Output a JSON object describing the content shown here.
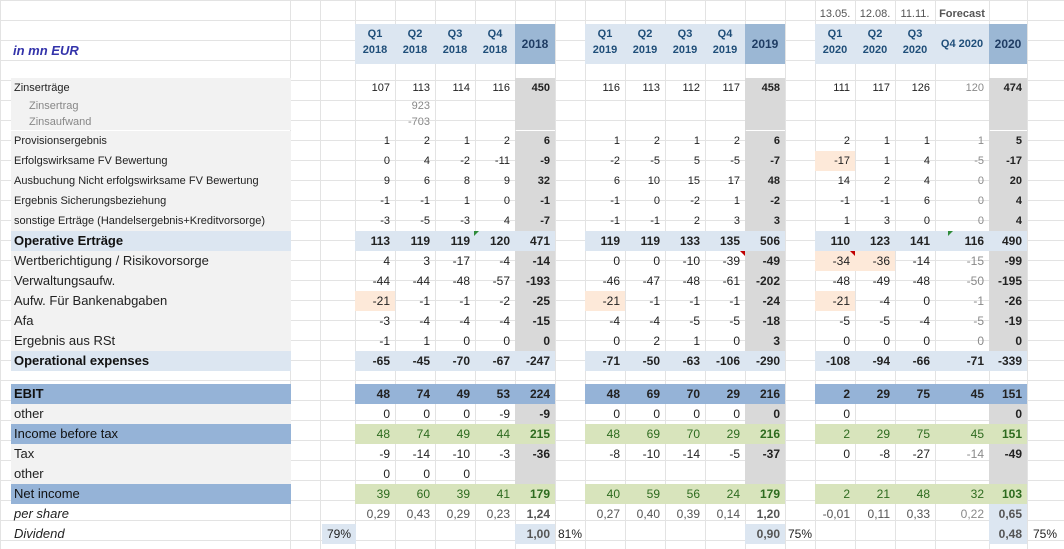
{
  "header": {
    "unit_label": "in mn EUR",
    "dates": [
      "13.05.",
      "12.08.",
      "11.11.",
      "Forecast"
    ],
    "columns": [
      [
        "Q1",
        "2018"
      ],
      [
        "Q2",
        "2018"
      ],
      [
        "Q3",
        "2018"
      ],
      [
        "Q4",
        "2018"
      ],
      [
        "2018"
      ],
      [
        "Q1",
        "2019"
      ],
      [
        "Q2",
        "2019"
      ],
      [
        "Q3",
        "2019"
      ],
      [
        "Q4",
        "2019"
      ],
      [
        "2019"
      ],
      [
        "Q1",
        "2020"
      ],
      [
        "Q2",
        "2020"
      ],
      [
        "Q3",
        "2020"
      ],
      [
        "Q4 2020"
      ],
      [
        "2020"
      ]
    ]
  },
  "colors": {
    "header_fill": "#dce6f1",
    "total_fill": "#9bb7d4",
    "section_fill": "#dce6f1",
    "ebit_fill": "#95b3d7",
    "label_fill": "#f2f2f2",
    "green_fill": "#d8e4bc",
    "gray_fill": "#d9d9d9",
    "peach_fill": "#fde9d9"
  },
  "rows": [
    {
      "label": "Zinserträge",
      "style": "plain",
      "values": [
        "107",
        "113",
        "114",
        "116",
        "450",
        "116",
        "113",
        "112",
        "117",
        "458",
        "111",
        "117",
        "126",
        "120",
        "474"
      ]
    },
    {
      "label": "Zinsertrag",
      "style": "sub",
      "values": [
        "",
        "923",
        "",
        "",
        "",
        "",
        "",
        "",
        "",
        "",
        "",
        "",
        "",
        "",
        ""
      ]
    },
    {
      "label": "Zinsaufwand",
      "style": "sub",
      "values": [
        "",
        "-703",
        "",
        "",
        "",
        "",
        "",
        "",
        "",
        "",
        "",
        "",
        "",
        "",
        ""
      ]
    },
    {
      "label": "Provisionsergebnis",
      "style": "plain",
      "values": [
        "1",
        "2",
        "1",
        "2",
        "6",
        "1",
        "2",
        "1",
        "2",
        "6",
        "2",
        "1",
        "1",
        "1",
        "5"
      ]
    },
    {
      "label": "Erfolgswirksame FV Bewertung",
      "style": "plain",
      "values": [
        "0",
        "4",
        "-2",
        "-11",
        "-9",
        "-2",
        "-5",
        "5",
        "-5",
        "-7",
        "-17",
        "1",
        "4",
        "-5",
        "-17"
      ]
    },
    {
      "label": "Ausbuchung Nicht erfolgswirksame FV Bewertung",
      "style": "plain",
      "values": [
        "9",
        "6",
        "8",
        "9",
        "32",
        "6",
        "10",
        "15",
        "17",
        "48",
        "14",
        "2",
        "4",
        "0",
        "20"
      ]
    },
    {
      "label": "Ergebnis Sicherungsbeziehung",
      "style": "plain",
      "values": [
        "-1",
        "-1",
        "1",
        "0",
        "-1",
        "-1",
        "0",
        "-2",
        "1",
        "-2",
        "-1",
        "-1",
        "6",
        "0",
        "4"
      ]
    },
    {
      "label": "sonstige Erträge (Handelsergebnis+Kreditvorsorge)",
      "style": "plain",
      "values": [
        "-3",
        "-5",
        "-3",
        "4",
        "-7",
        "-1",
        "-1",
        "2",
        "3",
        "3",
        "1",
        "3",
        "0",
        "0",
        "4"
      ]
    },
    {
      "label": "Operative Erträge",
      "style": "section",
      "values": [
        "113",
        "119",
        "119",
        "120",
        "471",
        "119",
        "119",
        "133",
        "135",
        "506",
        "110",
        "123",
        "141",
        "116",
        "490"
      ]
    },
    {
      "label": "Wertberichtigung / Risikovorsorge",
      "style": "big",
      "values": [
        "4",
        "3",
        "-17",
        "-4",
        "-14",
        "0",
        "0",
        "-10",
        "-39",
        "-49",
        "-34",
        "-36",
        "-14",
        "-15",
        "-99"
      ]
    },
    {
      "label": "Verwaltungsaufw.",
      "style": "big",
      "values": [
        "-44",
        "-44",
        "-48",
        "-57",
        "-193",
        "-46",
        "-47",
        "-48",
        "-61",
        "-202",
        "-48",
        "-49",
        "-48",
        "-50",
        "-195"
      ]
    },
    {
      "label": "Aufw. Für Bankenabgaben",
      "style": "big",
      "values": [
        "-21",
        "-1",
        "-1",
        "-2",
        "-25",
        "-21",
        "-1",
        "-1",
        "-1",
        "-24",
        "-21",
        "-4",
        "0",
        "-1",
        "-26"
      ]
    },
    {
      "label": "Afa",
      "style": "big",
      "values": [
        "-3",
        "-4",
        "-4",
        "-4",
        "-15",
        "-4",
        "-4",
        "-5",
        "-5",
        "-18",
        "-5",
        "-5",
        "-4",
        "-5",
        "-19"
      ]
    },
    {
      "label": "Ergebnis aus RSt",
      "style": "big",
      "values": [
        "-1",
        "1",
        "0",
        "0",
        "0",
        "0",
        "2",
        "1",
        "0",
        "3",
        "0",
        "0",
        "0",
        "0",
        "0"
      ]
    },
    {
      "label": "Operational expenses",
      "style": "section",
      "values": [
        "-65",
        "-45",
        "-70",
        "-67",
        "-247",
        "-71",
        "-50",
        "-63",
        "-106",
        "-290",
        "-108",
        "-94",
        "-66",
        "-71",
        "-339"
      ]
    },
    {
      "label": "EBIT",
      "style": "ebit",
      "values": [
        "48",
        "74",
        "49",
        "53",
        "224",
        "48",
        "69",
        "70",
        "29",
        "216",
        "2",
        "29",
        "75",
        "45",
        "151"
      ]
    },
    {
      "label": "other",
      "style": "big",
      "values": [
        "0",
        "0",
        "0",
        "-9",
        "-9",
        "0",
        "0",
        "0",
        "0",
        "0",
        "0",
        "",
        "",
        "",
        "0"
      ]
    },
    {
      "label": "Income before tax",
      "style": "blue",
      "values": [
        "48",
        "74",
        "49",
        "44",
        "215",
        "48",
        "69",
        "70",
        "29",
        "216",
        "2",
        "29",
        "75",
        "45",
        "151"
      ]
    },
    {
      "label": "Tax",
      "style": "big",
      "values": [
        "-9",
        "-14",
        "-10",
        "-3",
        "-36",
        "-8",
        "-10",
        "-14",
        "-5",
        "-37",
        "0",
        "-8",
        "-27",
        "-14",
        "-49"
      ]
    },
    {
      "label": "other",
      "style": "big",
      "values": [
        "0",
        "0",
        "0",
        "",
        "",
        "",
        "",
        "",
        "",
        "",
        "",
        "",
        "",
        "",
        ""
      ]
    },
    {
      "label": "Net income",
      "style": "blue",
      "values": [
        "39",
        "60",
        "39",
        "41",
        "179",
        "40",
        "59",
        "56",
        "24",
        "179",
        "2",
        "21",
        "48",
        "32",
        "103"
      ]
    },
    {
      "label": "per share",
      "style": "italic",
      "values": [
        "0,29",
        "0,43",
        "0,29",
        "0,23",
        "1,24",
        "0,27",
        "0,40",
        "0,39",
        "0,14",
        "1,20",
        "-0,01",
        "0,11",
        "0,33",
        "0,22",
        "0,65"
      ]
    },
    {
      "label": "Dividend",
      "style": "italic",
      "values": [
        "",
        "",
        "",
        "",
        "1,00",
        "",
        "",
        "",
        "",
        "0,90",
        "",
        "",
        "",
        "",
        "0,48"
      ]
    }
  ],
  "payout_ratios": [
    "79%",
    "81%",
    "75%",
    "75%"
  ]
}
